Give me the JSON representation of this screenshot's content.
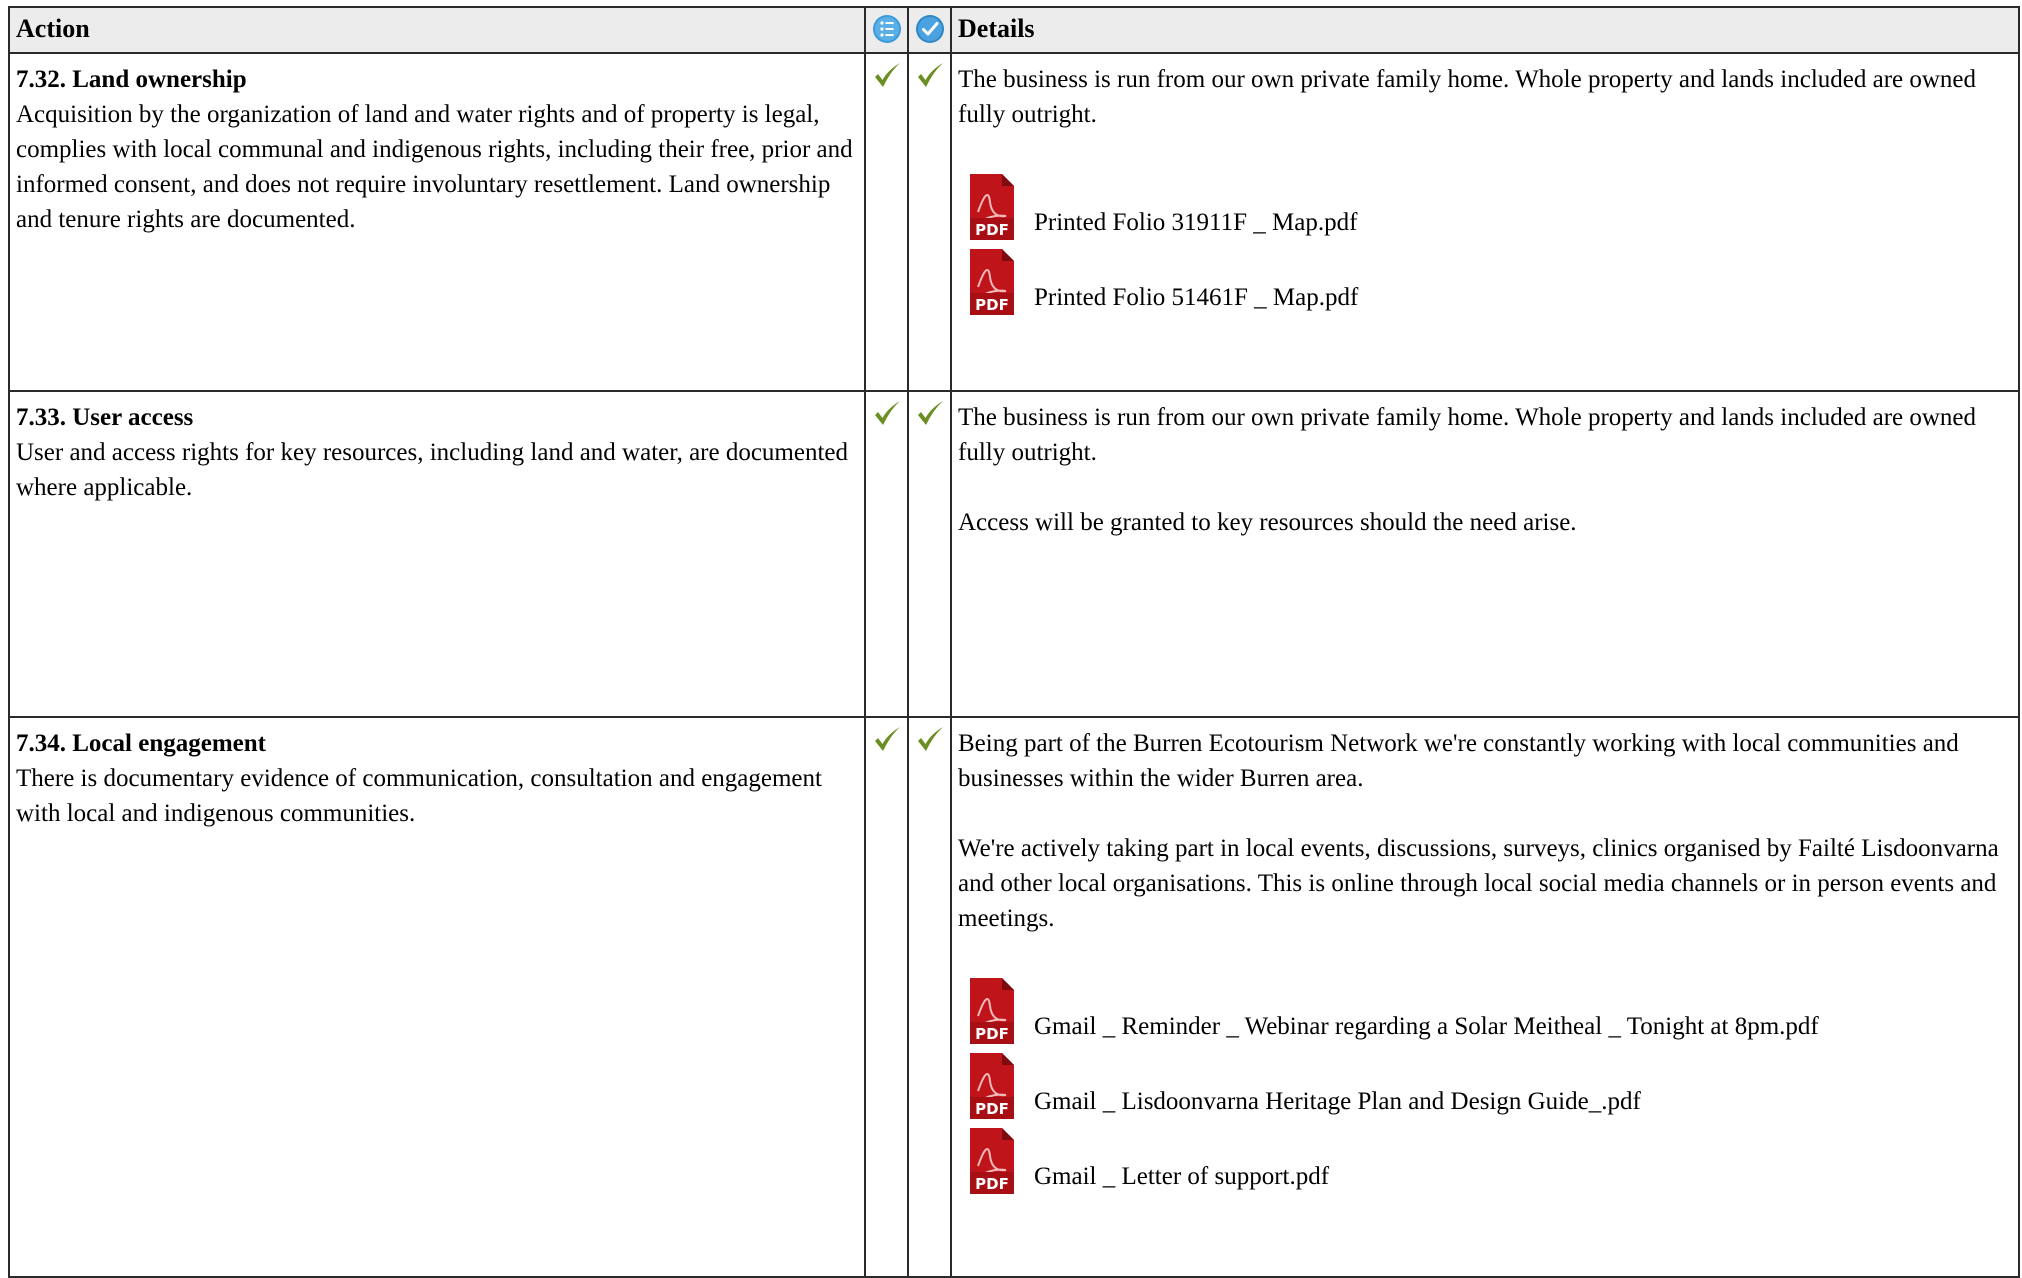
{
  "header": {
    "action_label": "Action",
    "details_label": "Details",
    "icon1": "info-list-icon",
    "icon2": "verified-check-icon"
  },
  "colors": {
    "header_bg": "#ececec",
    "icon_blue": "#3a9ad9",
    "check_green": "#6b8e23",
    "pdf_red": "#c0141b"
  },
  "rows": [
    {
      "title": "7.32. Land ownership",
      "description": "Acquisition by the organization of land and water rights and of property is legal, complies with local communal and indigenous rights, including their free, prior and informed consent, and does not require involuntary resettlement. Land ownership and tenure rights are documented.",
      "status1": "check-icon",
      "status2": "check-icon",
      "details": [
        "The business is run from our own private family home. Whole property and lands included are owned fully outright."
      ],
      "attachments": [
        "Printed Folio 31911F _ Map.pdf",
        "Printed Folio 51461F _ Map.pdf"
      ]
    },
    {
      "title": "7.33. User access",
      "description": "User and access rights for key resources, including land and water, are documented where applicable.",
      "status1": "check-icon",
      "status2": "check-icon",
      "details": [
        "The business is run from our own private family home. Whole property and lands included are owned fully outright.",
        "Access will be granted to key resources should the need arise."
      ],
      "attachments": []
    },
    {
      "title": "7.34. Local engagement",
      "description": "There is documentary evidence of communication, consultation and engagement with local and indigenous communities.",
      "status1": "check-icon",
      "status2": "check-icon",
      "details": [
        "Being part of the Burren Ecotourism Network we're constantly working with local communities and businesses within the wider Burren area.",
        "We're actively taking part in local events, discussions, surveys, clinics organised by Failté Lisdoonvarna and other local organisations. This is online through local social media channels or in person events and meetings."
      ],
      "attachments": [
        "Gmail _ Reminder _ Webinar regarding a Solar Meitheal _ Tonight at 8pm.pdf",
        "Gmail _ Lisdoonvarna Heritage Plan and Design Guide_.pdf",
        "Gmail _ Letter of support.pdf"
      ]
    }
  ]
}
